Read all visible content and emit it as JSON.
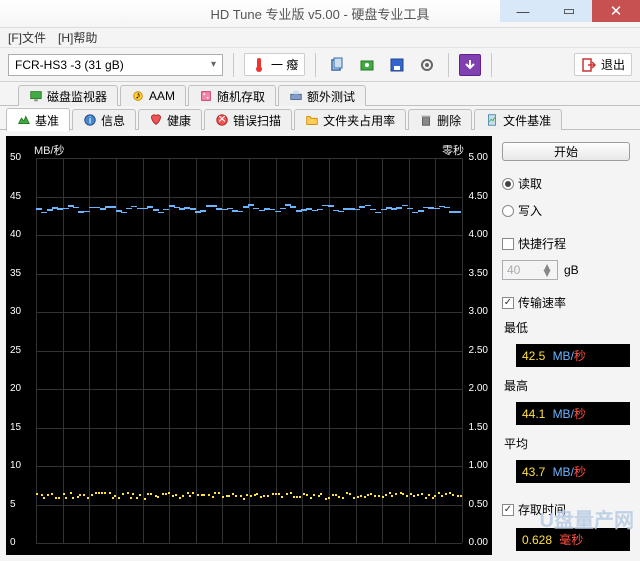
{
  "window": {
    "title": "HD Tune 专业版 v5.00 - 硬盘专业工具"
  },
  "menu": {
    "file": "[F]文件",
    "help": "[H]帮助"
  },
  "toolbar": {
    "drive": "FCR-HS3      -3 (31 gB)",
    "temp": "一 癈",
    "exit": "退出"
  },
  "tabs_top": [
    {
      "icon": "monitor",
      "label": "磁盘监视器"
    },
    {
      "icon": "aam",
      "label": "AAM"
    },
    {
      "icon": "random",
      "label": "随机存取"
    },
    {
      "icon": "extra",
      "label": "额外测试"
    }
  ],
  "tabs_bottom": [
    {
      "icon": "bench",
      "label": "基准",
      "active": true
    },
    {
      "icon": "info",
      "label": "信息"
    },
    {
      "icon": "health",
      "label": "健康"
    },
    {
      "icon": "error",
      "label": "错误扫描"
    },
    {
      "icon": "folder",
      "label": "文件夹占用率"
    },
    {
      "icon": "delete",
      "label": "删除"
    },
    {
      "icon": "filebench",
      "label": "文件基准"
    }
  ],
  "chart": {
    "y_left_unit": "MB/秒",
    "y_right_unit": "零秒",
    "y_left": [
      "50",
      "45",
      "40",
      "35",
      "30",
      "25",
      "20",
      "15",
      "10",
      "5",
      "0"
    ],
    "y_right": [
      "5.00",
      "4.50",
      "4.00",
      "3.50",
      "3.00",
      "2.50",
      "2.00",
      "1.50",
      "1.00",
      "0.50",
      "0.00"
    ]
  },
  "chart_data": {
    "type": "line",
    "title": "",
    "xlabel": "",
    "ylabel_left": "MB/秒",
    "ylabel_right": "毫秒",
    "ylim_left": [
      0,
      50
    ],
    "ylim_right": [
      0,
      5
    ],
    "series": [
      {
        "name": "传输速率",
        "axis": "left",
        "approx_constant": 43.5,
        "min": 42.5,
        "max": 44.1,
        "avg": 43.7
      },
      {
        "name": "存取时间",
        "axis": "right",
        "approx_constant": 0.63,
        "value": 0.628
      }
    ]
  },
  "side": {
    "start": "开始",
    "read": "读取",
    "write": "写入",
    "short_stroke": "快捷行程",
    "short_val": "40",
    "gb": "gB",
    "rate": "传输速率",
    "min": "最低",
    "min_val": "42.5",
    "max": "最高",
    "max_val": "44.1",
    "avg": "平均",
    "avg_val": "43.7",
    "unit_mb": "MB/",
    "unit_s": "秒",
    "access": "存取时间",
    "access_val": "0.628",
    "access_unit": "毫秒"
  },
  "watermark": {
    "main": "U盘量产网",
    "sub": ""
  }
}
